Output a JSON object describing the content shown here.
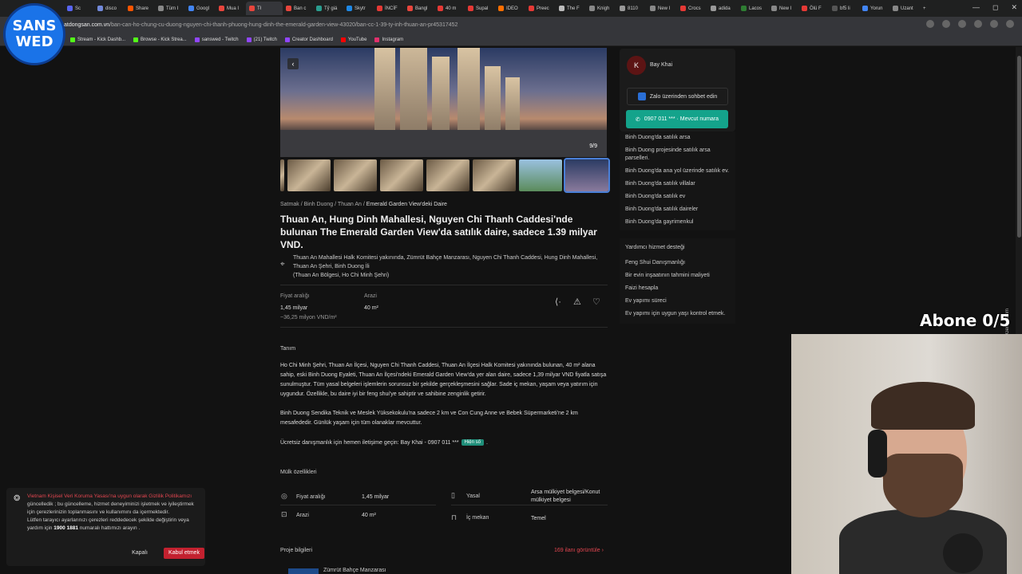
{
  "browser": {
    "tabs": [
      {
        "label": "Sc"
      },
      {
        "label": "disco"
      },
      {
        "label": "Share"
      },
      {
        "label": "Tüm I"
      },
      {
        "label": "Googl"
      },
      {
        "label": "Mua I"
      },
      {
        "label": "Tł",
        "active": true
      },
      {
        "label": "Ban c"
      },
      {
        "label": "Tỷ giá"
      },
      {
        "label": "Skytr"
      },
      {
        "label": "İNCİF"
      },
      {
        "label": "Bangl"
      },
      {
        "label": "40 m"
      },
      {
        "label": "Supal"
      },
      {
        "label": "IDEO"
      },
      {
        "label": "Preec"
      },
      {
        "label": "The F"
      },
      {
        "label": "Knigh"
      },
      {
        "label": "8110"
      },
      {
        "label": "New I"
      },
      {
        "label": "Crocs"
      },
      {
        "label": "adida"
      },
      {
        "label": "Lacos"
      },
      {
        "label": "New I"
      },
      {
        "label": "Ölü F"
      },
      {
        "label": "bf5 li"
      },
      {
        "label": "Yorun"
      },
      {
        "label": "Uzant"
      }
    ],
    "window_controls": {
      "minimize": "—",
      "maximize": "◻",
      "close": "✕",
      "new_tab": "+"
    },
    "url_host": "atdongsan.com.vn",
    "url_path": "/ban-can-ho-chung-cu-duong-nguyen-chi-thanh-phuong-hung-dinh-the-emerald-garden-view-43020/ban-cc-1-39-ty-inh-thuan-an-pr45317452",
    "bookmarks": [
      {
        "label": "Stream - Kick Dashb...",
        "color": "#53fc18"
      },
      {
        "label": "Browse - Kick Strea...",
        "color": "#53fc18"
      },
      {
        "label": "sanswed - Twitch",
        "color": "#9146ff"
      },
      {
        "label": "(21) Twitch",
        "color": "#9146ff"
      },
      {
        "label": "Creator Dashboard",
        "color": "#9146ff"
      },
      {
        "label": "YouTube",
        "color": "#ff0000"
      },
      {
        "label": "Instagram",
        "color": "#e1306c"
      }
    ]
  },
  "logo": {
    "line1": "SANS",
    "line2": "WED"
  },
  "listing": {
    "hero_counter": "9/9",
    "prev_arrow": "‹",
    "breadcrumb": {
      "a": "Satmak",
      "b": "Binh Duong",
      "c": "Thuan An",
      "current": "Emerald Garden View'deki Daire",
      "sep": "/"
    },
    "title": "Thuan An, Hung Dinh Mahallesi, Nguyen Chi Thanh Caddesi'nde bulunan The Emerald Garden View'da satılık daire, sadece 1.39 milyar VND.",
    "address": "Thuan An Mahallesi Halk Komitesi yakınında, Zümrüt Bahçe Manzarası, Nguyen Chi Thanh Caddesi, Hung Dinh Mahallesi, Thuan An Şehri, Binh Duong İli",
    "address_sub": "(Thuan An Bölgesi, Ho Chi Minh Şehri)",
    "price_label": "Fiyat aralığı",
    "price_value": "1,45 milyar",
    "price_per": "~36,25 milyon VND/m²",
    "area_label": "Arazi",
    "area_value": "40 m²",
    "description_heading": "Tanım",
    "description_p1": "Ho Chi Minh Şehri, Thuan An İlçesi, Nguyen Chi Thanh Caddesi, Thuan An İlçesi Halk Komitesi yakınında bulunan, 40 m² alana sahip, eski Binh Duong Eyaleti, Thuan An İlçesi'ndeki Emerald Garden View'da yer alan daire, sadece 1,39 milyar VND fiyatla satışa sunulmuştur. Tüm yasal belgeleri işlemlerin sorunsuz bir şekilde gerçekleşmesini sağlar. Sade iç mekan, yaşam veya yatırım için uygundur. Özellikle, bu daire iyi bir feng shui'ye sahiptir ve sahibine zenginlik getirir.",
    "description_p2": "Binh Duong Sendika Teknik ve Meslek Yüksekokulu'na sadece 2 km ve Con Cung Anne ve Bebek Süpermarketi'ne 2 km mesafededir. Günlük yaşam için tüm olanaklar mevcuttur.",
    "contact_prefix": "Ücretsiz danışmanlık için hemen iletişime geçin: Bay Khai - 0907 011 ***",
    "contact_badge": "Hiện số",
    "contact_suffix": ".",
    "features_heading": "Mülk özellikleri",
    "features": {
      "price_label": "Fiyat aralığı",
      "price_value": "1,45 milyar",
      "area_label": "Arazi",
      "area_value": "40 m²",
      "legal_label": "Yasal",
      "legal_value": "Arsa mülkiyet belgesi/Konut mülkiyet belgesi",
      "interior_label": "İç mekan",
      "interior_value": "Temel"
    },
    "project_heading": "Proje bilgileri",
    "project_link": "169 ilanı görüntüle",
    "project_link_arrow": "›",
    "project_name": "Zümrüt Bahçe Manzarası"
  },
  "sidebar": {
    "agent_initial": "K",
    "agent_name": "Bay Khai",
    "zalo_label": "Zalo üzerinden sohbet edin",
    "phone_label": "0907 011 *** · Mevcut numara",
    "related_links": [
      "Binh Duong'da satılık arsa",
      "Binh Duong projesinde satılık arsa parselleri.",
      "Binh Duong'da ana yol üzerinde satılık ev.",
      "Binh Duong'da satılık villalar",
      "Binh Duong'da satılık ev",
      "Binh Duong'da satılık daireler",
      "Binh Duong'da gayrimenkul"
    ],
    "service_heading": "Yardımcı hizmet desteği",
    "service_links": [
      "Feng Shui Danışmanlığı",
      "Bir evin inşaatının tahmini maliyeti",
      "Faizi hesapla",
      "Ev yapımı süreci",
      "Ev yapımı için uygun yaşı kontrol etmek."
    ],
    "feedback_label": "Geri bildirim"
  },
  "cookie": {
    "link_text": "Vietnam Kişisel Veri Koruma Yasası'na uygun olarak Gizlilik Politikamızı",
    "text1": " güncelledik ; bu güncelleme, hizmet deneyiminizi işletmek ve iyileştirmek için çerezlerinizin toplanmasını ve kullanımını da içermektedir.",
    "text2": "Lütfen tarayıcı ayarlarınızı çerezleri reddedecek şekilde değiştirin veya yardım için ",
    "hotline": "1900 1881",
    "text3": " numaralı hattımızı arayın .",
    "close_label": "Kapalı",
    "accept_label": "Kabul etmek"
  },
  "overlay": {
    "sub_counter": "Abone 0/5"
  },
  "colors": {
    "accent_teal": "#14a38b",
    "accent_red": "#c3212f",
    "link_red": "#e0454f"
  }
}
